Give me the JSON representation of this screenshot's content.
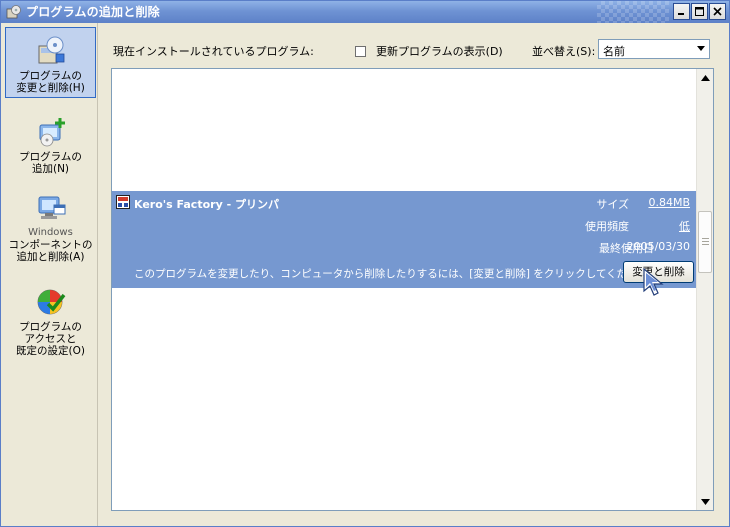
{
  "window": {
    "title": "プログラムの追加と削除",
    "accent": "#6f93d4"
  },
  "sidebar": {
    "items": [
      {
        "label": "プログラムの\n変更と削除(H)",
        "icon": "change-remove-programs-icon",
        "selected": true
      },
      {
        "label": "プログラムの\n追加(N)",
        "icon": "add-programs-icon"
      },
      {
        "label_top": "Windows",
        "label": "コンポーネントの\n追加と削除(A)",
        "icon": "windows-components-icon"
      },
      {
        "label": "プログラムの\nアクセスと\n既定の設定(O)",
        "icon": "program-access-defaults-icon"
      }
    ]
  },
  "toolbar": {
    "current_programs_label": "現在インストールされているプログラム:",
    "show_updates_label": "更新プログラムの表示(D)",
    "show_updates_checked": false,
    "sort_label": "並べ替え(S):",
    "sort_value": "名前"
  },
  "program": {
    "name": "Kero's Factory - プリンパ",
    "size_label": "サイズ",
    "size_value": "0.84MB",
    "usage_label": "使用頻度",
    "usage_value": "低",
    "last_used_label": "最終使用日",
    "last_used_value": "2005/03/30",
    "description": "このプログラムを変更したり、コンピュータから削除したりするには、[変更と削除] をクリックしてください。",
    "button_label": "変更と削除",
    "highlight_color": "#7698d0"
  }
}
